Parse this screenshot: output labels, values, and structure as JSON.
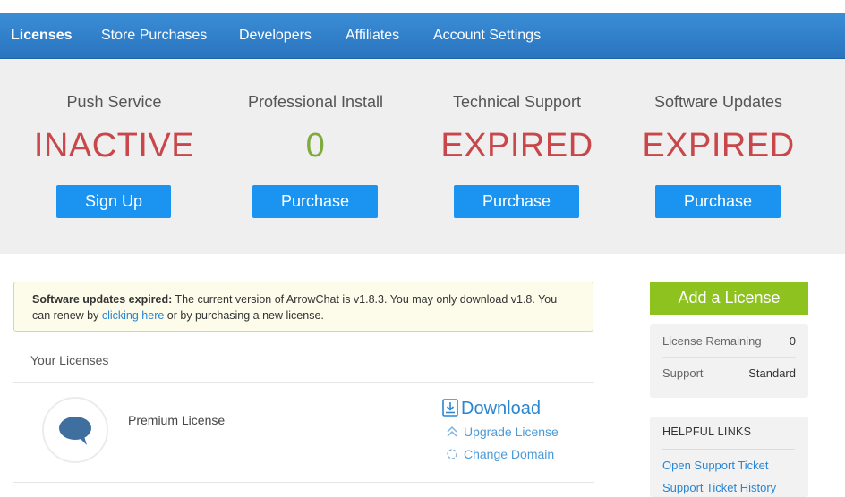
{
  "nav": {
    "items": [
      {
        "label": "Licenses",
        "active": true
      },
      {
        "label": "Store Purchases"
      },
      {
        "label": "Developers"
      },
      {
        "label": "Affiliates"
      },
      {
        "label": "Account Settings"
      }
    ]
  },
  "status": [
    {
      "title": "Push Service",
      "value": "INACTIVE",
      "button": "Sign Up",
      "value_color": "#c9474a"
    },
    {
      "title": "Professional Install",
      "value": "0",
      "button": "Purchase",
      "value_color": "#7fab3a"
    },
    {
      "title": "Technical Support",
      "value": "EXPIRED",
      "button": "Purchase",
      "value_color": "#c9474a"
    },
    {
      "title": "Software Updates",
      "value": "EXPIRED",
      "button": "Purchase",
      "value_color": "#c9474a"
    }
  ],
  "alert": {
    "bold": "Software updates expired:",
    "text1": " The current version of ArrowChat is v1.8.3. You may only download v1.8. You can renew by ",
    "link": "clicking here",
    "text2": " or by purchasing a new license."
  },
  "licenses": {
    "heading": "Your Licenses",
    "items": [
      {
        "icon": "chat-bubble-icon",
        "name": "Premium License",
        "download": "Download",
        "upgrade": "Upgrade License",
        "change_domain": "Change Domain"
      }
    ]
  },
  "sidebar": {
    "add_license": "Add a License",
    "info": [
      {
        "key": "License Remaining",
        "value": "0"
      },
      {
        "key": "Support",
        "value": "Standard"
      }
    ],
    "helpful_links_title": "HELPFUL LINKS",
    "helpful_links": [
      "Open Support Ticket",
      "Support Ticket History"
    ]
  },
  "colors": {
    "nav": "#2a74bf",
    "primary_button": "#1a94f0",
    "add_button": "#8dc21f",
    "expired": "#c9474a",
    "ok": "#7fab3a",
    "link": "#2a86d1"
  }
}
